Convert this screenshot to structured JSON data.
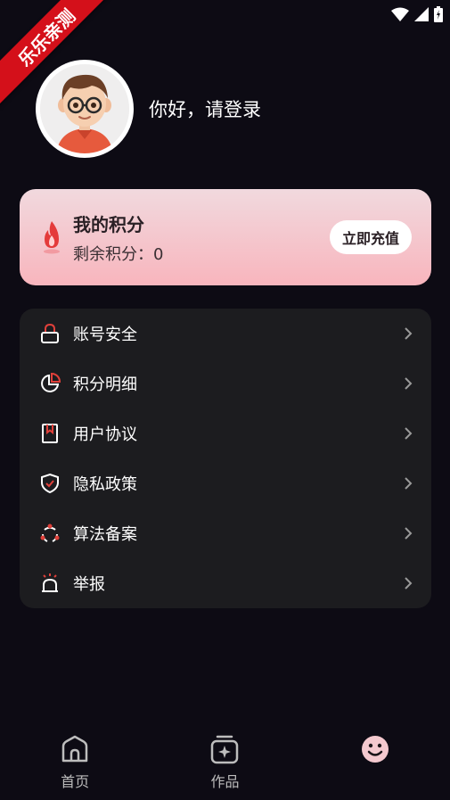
{
  "ribbon": {
    "text": "乐乐亲测"
  },
  "profile": {
    "login_text": "你好，请登录"
  },
  "points_card": {
    "title": "我的积分",
    "remaining": "剩余积分：0",
    "recharge_label": "立即充值"
  },
  "menu": {
    "items": [
      {
        "label": "账号安全",
        "icon": "lock-icon"
      },
      {
        "label": "积分明细",
        "icon": "pie-chart-icon"
      },
      {
        "label": "用户协议",
        "icon": "bookmark-document-icon"
      },
      {
        "label": "隐私政策",
        "icon": "shield-check-icon"
      },
      {
        "label": "算法备案",
        "icon": "algorithm-nodes-icon"
      },
      {
        "label": "举报",
        "icon": "alarm-siren-icon"
      }
    ]
  },
  "tabbar": {
    "items": [
      {
        "label": "首页",
        "icon": "home-icon"
      },
      {
        "label": "作品",
        "icon": "works-icon"
      },
      {
        "label": "",
        "icon": "smiley-profile-icon",
        "active": true
      }
    ]
  },
  "colors": {
    "background": "#0d0b14",
    "card_gradient_top": "#f1d9de",
    "card_gradient_bottom": "#f8b5bd",
    "accent_red": "#e0403a",
    "menu_bg": "#1c1c1f",
    "ribbon_red": "#d4101a"
  }
}
